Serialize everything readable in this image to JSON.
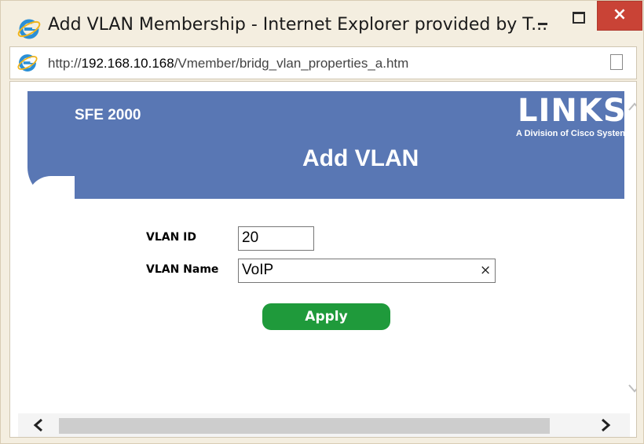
{
  "window": {
    "title": "Add VLAN Membership - Internet Explorer provided by T...",
    "minimize_icon": "minimize-icon",
    "maximize_icon": "maximize-icon",
    "close_icon": "close-icon",
    "close_glyph": "×"
  },
  "address_bar": {
    "prefix": "http://",
    "host": "192.168.10.168",
    "path": "/Vmember/bridg_vlan_properties_a.htm",
    "page_icon": "document-icon"
  },
  "banner": {
    "model": "SFE 2000",
    "title": "Add VLAN",
    "logo": "LINKSY",
    "logo_subtitle": "A Division of Cisco Systen",
    "color": "#5977b4"
  },
  "form": {
    "vlan_id_label": "VLAN ID",
    "vlan_id_value": "20",
    "vlan_name_label": "VLAN Name",
    "vlan_name_value": "VoIP",
    "clear_glyph": "×",
    "apply_label": "Apply",
    "apply_color": "#1f9a3b"
  },
  "scrollbars": {
    "left_arrow": "‹",
    "right_arrow": "›"
  },
  "colors": {
    "close_button": "#c94336",
    "frame": "#f4eee0"
  }
}
